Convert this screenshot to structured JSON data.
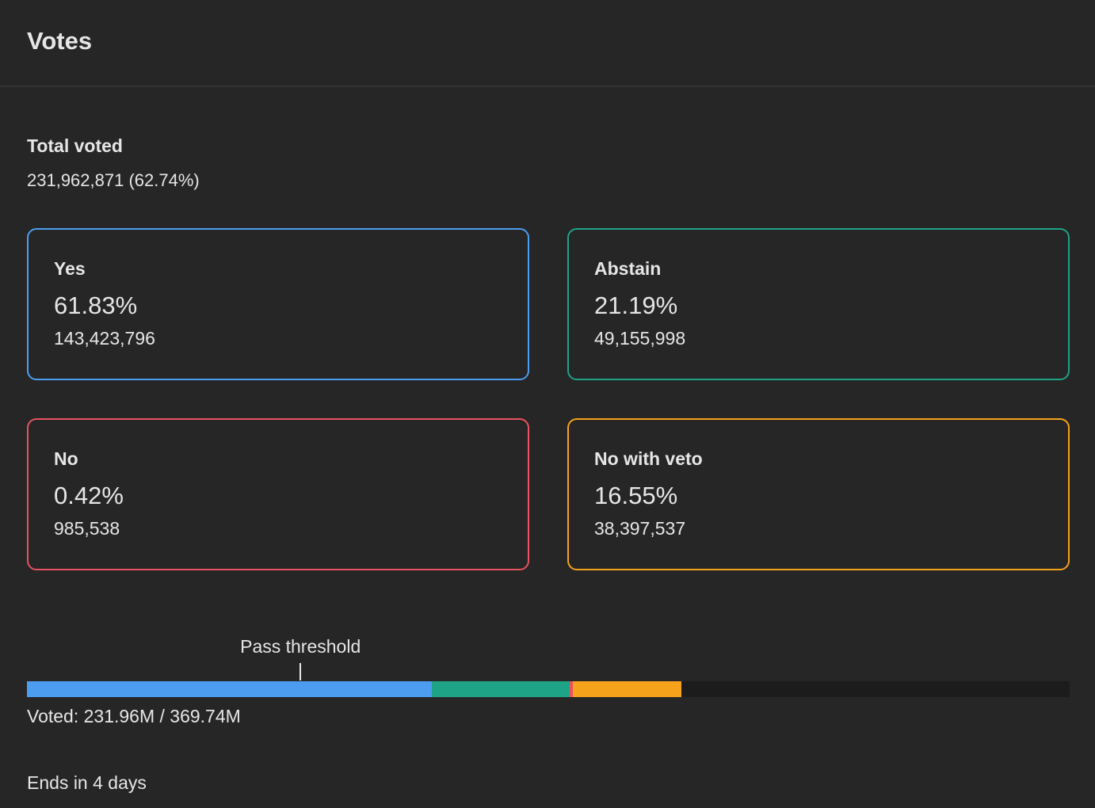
{
  "header": {
    "title": "Votes"
  },
  "total": {
    "label": "Total voted",
    "value": "231,962,871 (62.74%)"
  },
  "options": {
    "yes": {
      "label": "Yes",
      "percent": "61.83%",
      "count": "143,423,796",
      "color": "#4c9df0"
    },
    "abstain": {
      "label": "Abstain",
      "percent": "21.19%",
      "count": "49,155,998",
      "color": "#1fa387"
    },
    "no": {
      "label": "No",
      "percent": "0.42%",
      "count": "985,538",
      "color": "#e8535f"
    },
    "no_with_veto": {
      "label": "No with veto",
      "percent": "16.55%",
      "count": "38,397,537",
      "color": "#f7a21b"
    }
  },
  "progress": {
    "threshold_label": "Pass threshold",
    "threshold_fraction": 0.2623,
    "voted_fraction": 0.6274,
    "shares": {
      "yes": 0.6183,
      "abstain": 0.2119,
      "no": 0.0042,
      "no_with_veto": 0.1655
    },
    "voted_text": "Voted: 231.96M / 369.74M"
  },
  "footer": {
    "ends_text": "Ends in 4 days"
  }
}
